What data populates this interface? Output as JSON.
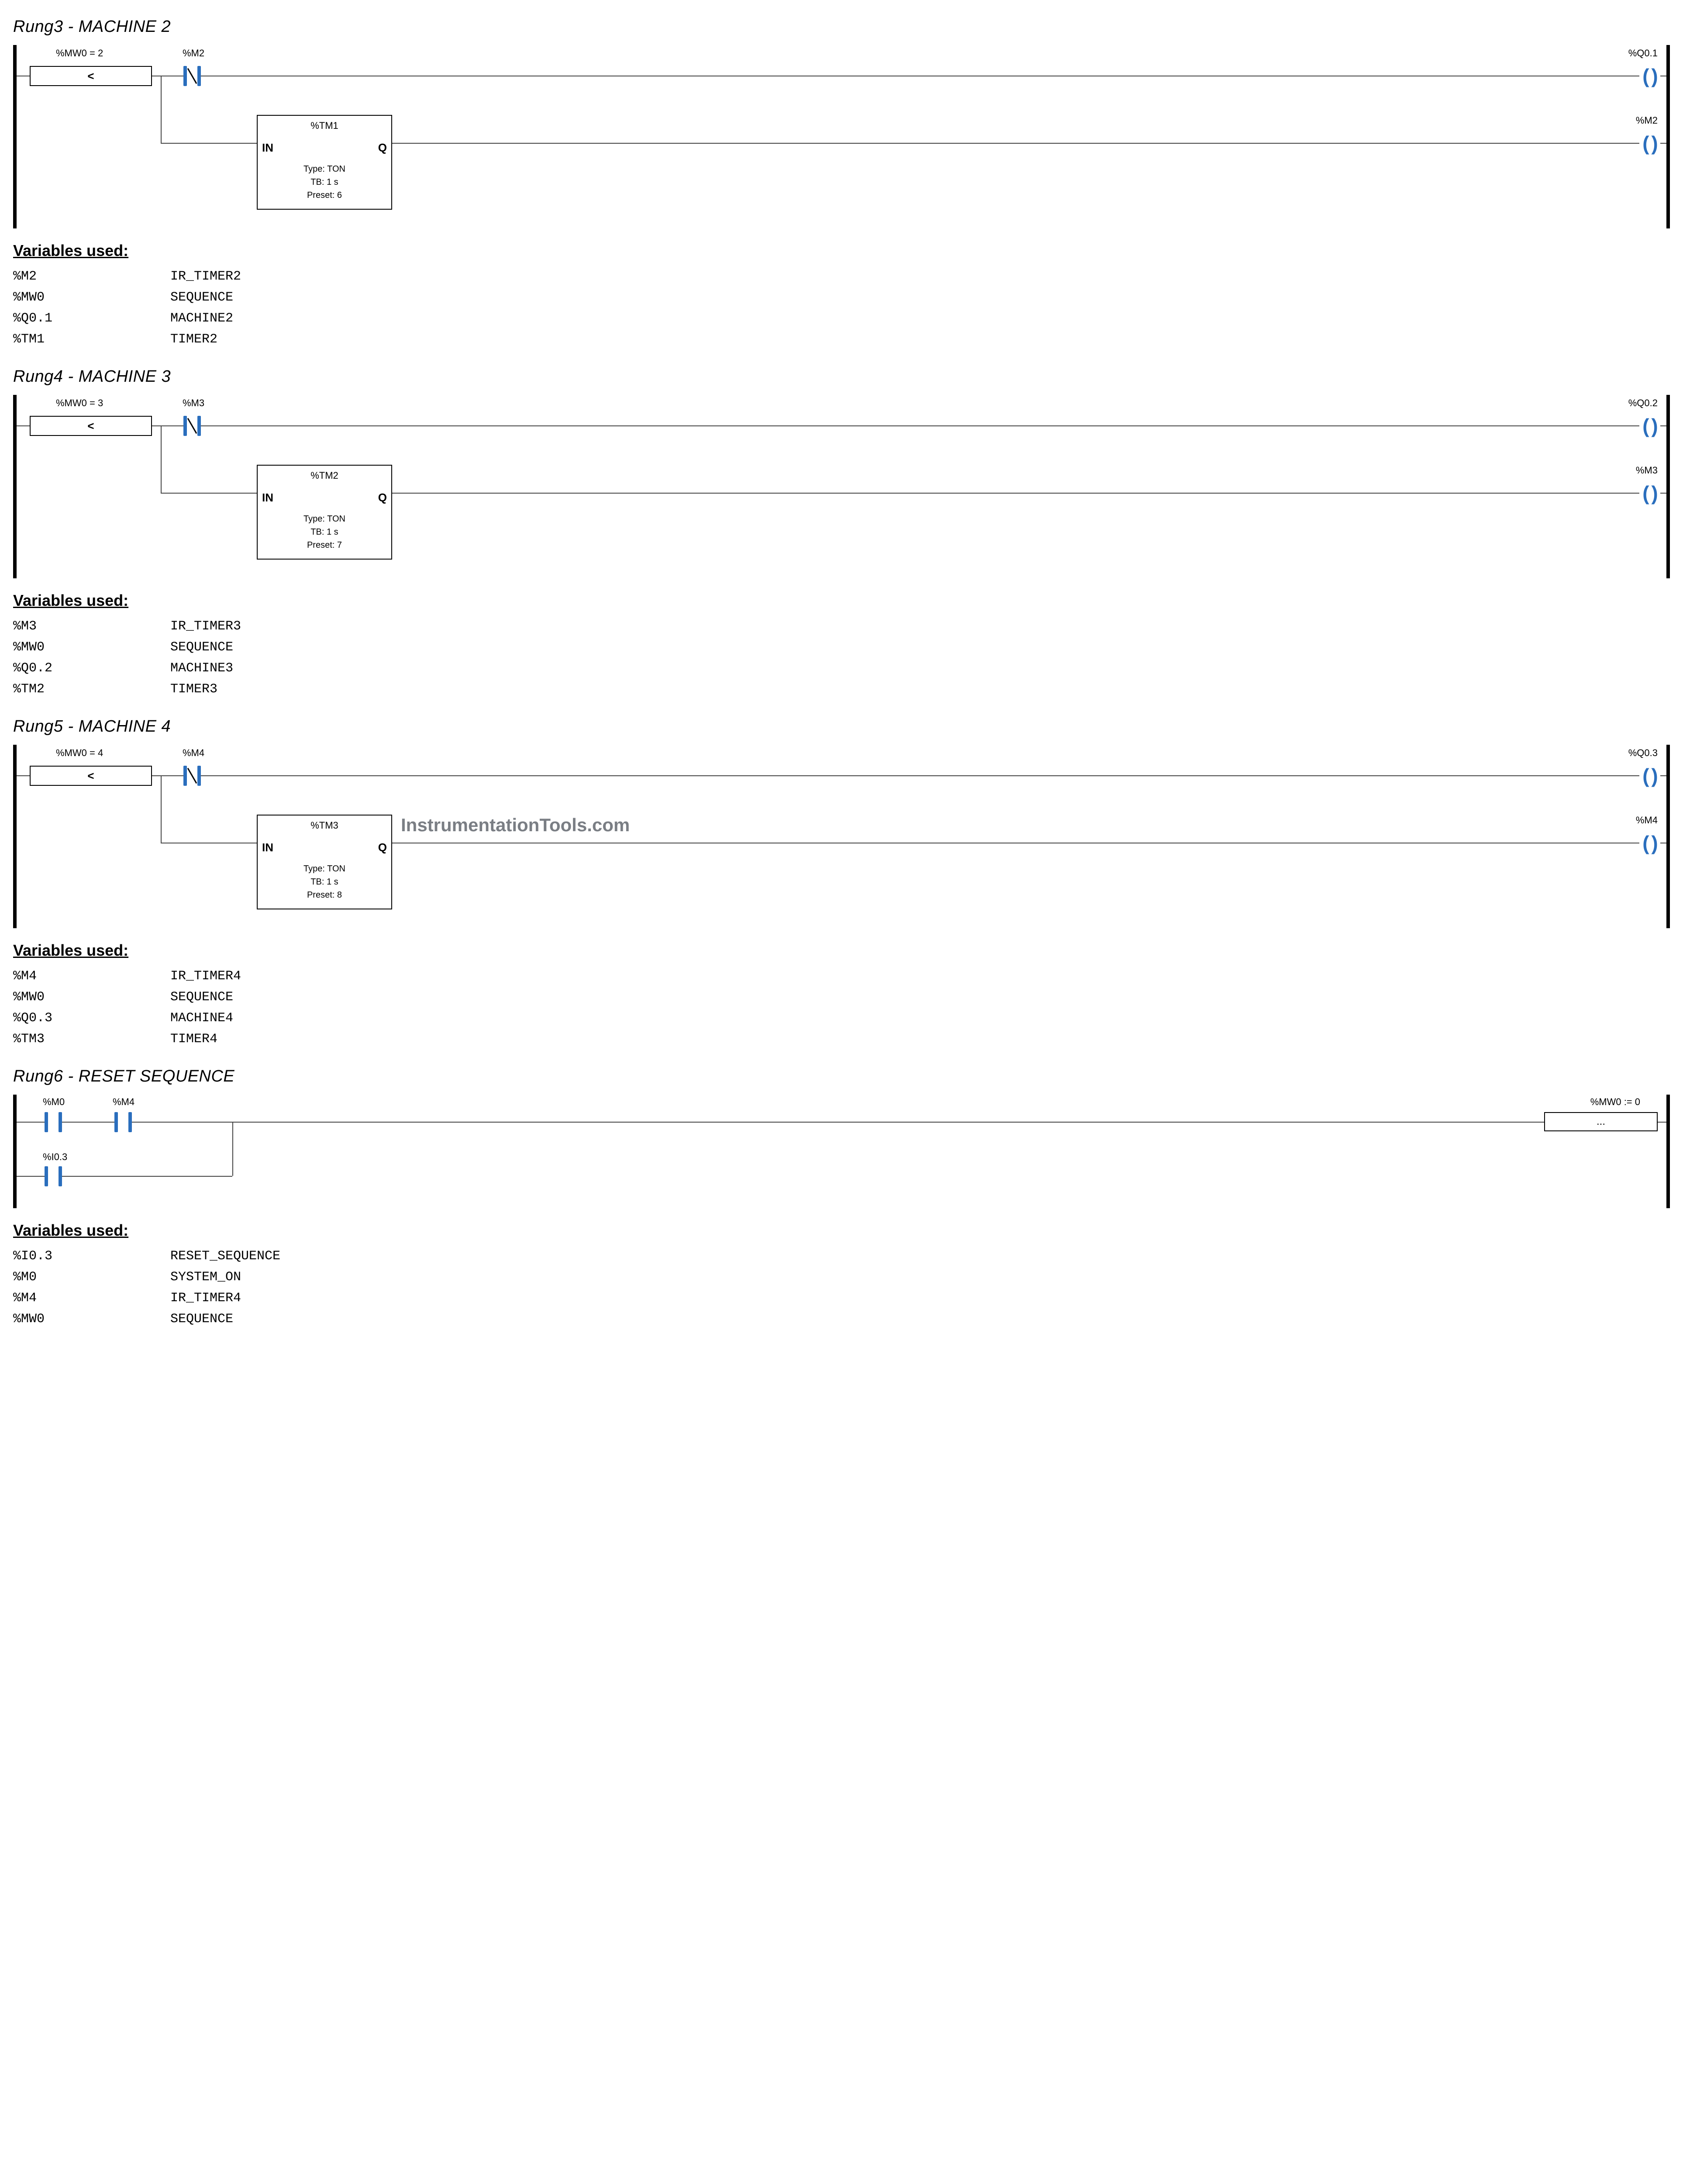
{
  "watermark": "InstrumentationTools.com",
  "rungs": [
    {
      "id": "rung3",
      "title": "Rung3 - MACHINE 2",
      "compare_label": "%MW0 = 2",
      "compare_op": "<",
      "contact_label": "%M2",
      "timer_name": "%TM1",
      "timer_type": "Type: TON",
      "timer_tb": "TB: 1 s",
      "timer_preset": "Preset: 6",
      "coil1_label": "%Q0.1",
      "coil2_label": "%M2",
      "in_label": "IN",
      "q_label": "Q",
      "vars": [
        {
          "k": "%M2",
          "v": "IR_TIMER2"
        },
        {
          "k": "%MW0",
          "v": "SEQUENCE"
        },
        {
          "k": "%Q0.1",
          "v": "MACHINE2"
        },
        {
          "k": "%TM1",
          "v": "TIMER2"
        }
      ]
    },
    {
      "id": "rung4",
      "title": "Rung4 - MACHINE 3",
      "compare_label": "%MW0 = 3",
      "compare_op": "<",
      "contact_label": "%M3",
      "timer_name": "%TM2",
      "timer_type": "Type: TON",
      "timer_tb": "TB: 1 s",
      "timer_preset": "Preset: 7",
      "coil1_label": "%Q0.2",
      "coil2_label": "%M3",
      "in_label": "IN",
      "q_label": "Q",
      "vars": [
        {
          "k": "%M3",
          "v": "IR_TIMER3"
        },
        {
          "k": "%MW0",
          "v": "SEQUENCE"
        },
        {
          "k": "%Q0.2",
          "v": "MACHINE3"
        },
        {
          "k": "%TM2",
          "v": "TIMER3"
        }
      ]
    },
    {
      "id": "rung5",
      "title": "Rung5 - MACHINE 4",
      "compare_label": "%MW0 = 4",
      "compare_op": "<",
      "contact_label": "%M4",
      "timer_name": "%TM3",
      "timer_type": "Type: TON",
      "timer_tb": "TB: 1 s",
      "timer_preset": "Preset: 8",
      "coil1_label": "%Q0.3",
      "coil2_label": "%M4",
      "in_label": "IN",
      "q_label": "Q",
      "vars": [
        {
          "k": "%M4",
          "v": "IR_TIMER4"
        },
        {
          "k": "%MW0",
          "v": "SEQUENCE"
        },
        {
          "k": "%Q0.3",
          "v": "MACHINE4"
        },
        {
          "k": "%TM3",
          "v": "TIMER4"
        }
      ]
    }
  ],
  "reset_rung": {
    "title": "Rung6 - RESET SEQUENCE",
    "c1_label": "%M0",
    "c2_label": "%M4",
    "c3_label": "%I0.3",
    "op_label": "%MW0 := 0",
    "op_text": "...",
    "vars": [
      {
        "k": "%I0.3",
        "v": "RESET_SEQUENCE"
      },
      {
        "k": "%M0",
        "v": "SYSTEM_ON"
      },
      {
        "k": "%M4",
        "v": "IR_TIMER4"
      },
      {
        "k": "%MW0",
        "v": "SEQUENCE"
      }
    ]
  },
  "vars_heading": "Variables used:"
}
